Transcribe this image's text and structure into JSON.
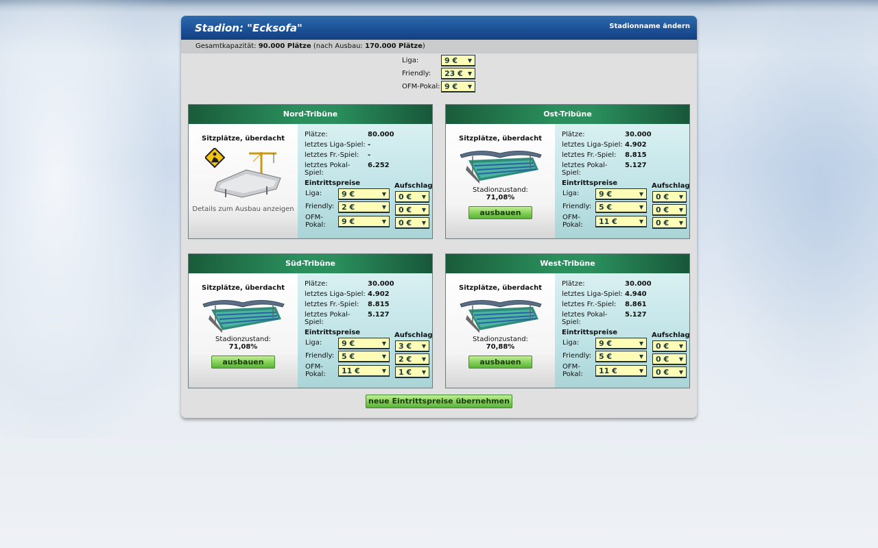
{
  "header": {
    "title": "Stadion: \"Ecksofa\"",
    "rename_link": "Stadionname ändern"
  },
  "capacity": {
    "label": "Gesamtkapazität:",
    "current": "90.000 Plätze",
    "after_label": "(nach Ausbau:",
    "after_value": "170.000 Plätze",
    "close": ")"
  },
  "global_prices": {
    "liga_label": "Liga:",
    "liga_value": "9 €",
    "friendly_label": "Friendly:",
    "friendly_value": "23 €",
    "pokal_label": "OFM-Pokal:",
    "pokal_value": "9 €"
  },
  "labels": {
    "plaetze": "Plätze:",
    "last_liga": "letztes Liga-Spiel:",
    "last_friendly": "letztes Fr.-Spiel:",
    "last_pokal": "letztes Pokal-Spiel:",
    "eintrittspreise": "Eintrittspreise",
    "aufschlag": "Aufschlag",
    "liga": "Liga:",
    "friendly": "Friendly:",
    "ofm": "OFM-",
    "pokal": "Pokal:",
    "stadionzustand": "Stadionzustand:",
    "ausbauen": "ausbauen",
    "details": "Details zum Ausbau anzeigen"
  },
  "stands": {
    "nord": {
      "name": "Nord-Tribüne",
      "seat_type": "Sitzplätze, überdacht",
      "plaetze": "80.000",
      "last_liga": "-",
      "last_friendly": "-",
      "last_pokal": "6.252",
      "price_liga": "9 €",
      "price_friendly": "2 €",
      "price_pokal": "9 €",
      "sur_liga": "0 €",
      "sur_friendly": "0 €",
      "sur_pokal": "0 €"
    },
    "ost": {
      "name": "Ost-Tribüne",
      "seat_type": "Sitzplätze, überdacht",
      "plaetze": "30.000",
      "last_liga": "4.902",
      "last_friendly": "8.815",
      "last_pokal": "5.127",
      "condition": "71,08%",
      "price_liga": "9 €",
      "price_friendly": "5 €",
      "price_pokal": "11 €",
      "sur_liga": "0 €",
      "sur_friendly": "0 €",
      "sur_pokal": "0 €"
    },
    "sued": {
      "name": "Süd-Tribüne",
      "seat_type": "Sitzplätze, überdacht",
      "plaetze": "30.000",
      "last_liga": "4.902",
      "last_friendly": "8.815",
      "last_pokal": "5.127",
      "condition": "71,08%",
      "price_liga": "9 €",
      "price_friendly": "5 €",
      "price_pokal": "11 €",
      "sur_liga": "3 €",
      "sur_friendly": "2 €",
      "sur_pokal": "1 €"
    },
    "west": {
      "name": "West-Tribüne",
      "seat_type": "Sitzplätze, überdacht",
      "plaetze": "30.000",
      "last_liga": "4.940",
      "last_friendly": "8.861",
      "last_pokal": "5.127",
      "condition": "70,88%",
      "price_liga": "9 €",
      "price_friendly": "5 €",
      "price_pokal": "11 €",
      "sur_liga": "0 €",
      "sur_friendly": "0 €",
      "sur_pokal": "0 €"
    }
  },
  "submit_label": "neue Eintrittspreise übernehmen"
}
